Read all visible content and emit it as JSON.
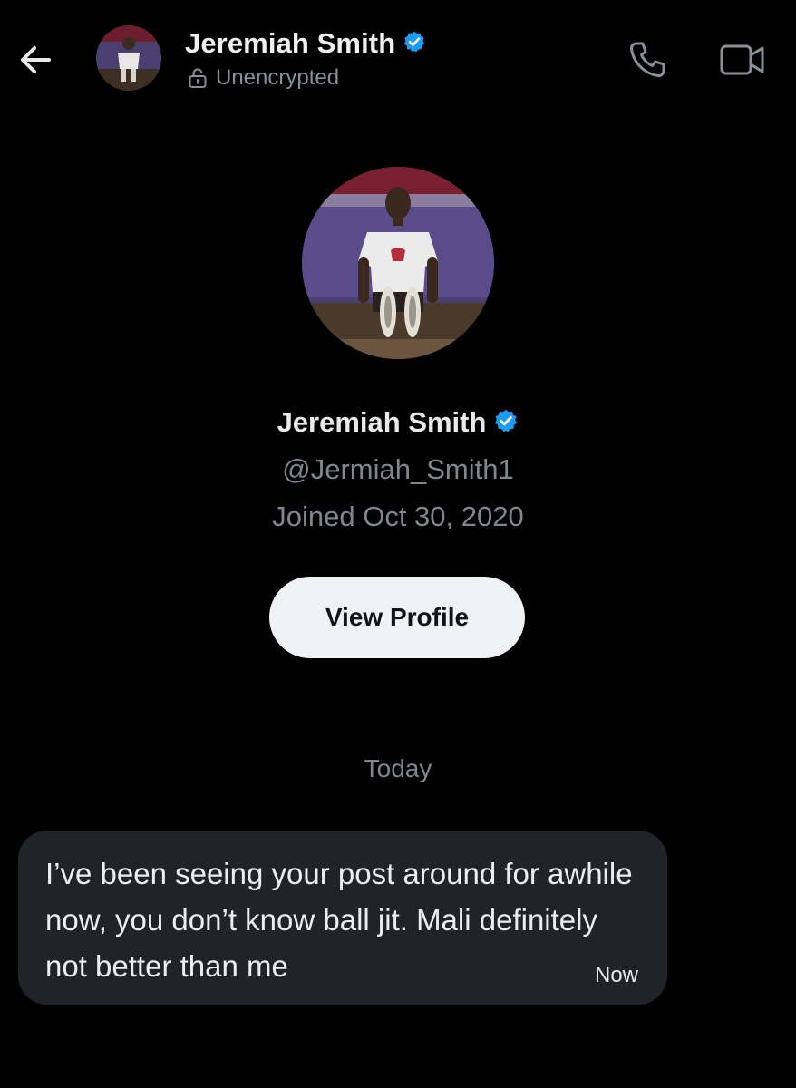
{
  "header": {
    "name": "Jeremiah Smith",
    "encryption_status": "Unencrypted",
    "back_icon": "arrow-left-icon",
    "call_icon": "phone-icon",
    "video_icon": "video-camera-icon"
  },
  "profile": {
    "name": "Jeremiah Smith",
    "handle": "@Jermiah_Smith1",
    "joined": "Joined Oct 30, 2020",
    "view_profile_label": "View Profile",
    "verified": true
  },
  "conversation": {
    "date_separator": "Today",
    "messages": [
      {
        "text": "I’ve been seeing your post around for awhile now, you don’t know ball jit. Mali definitely not better than me",
        "time": "Now"
      }
    ]
  },
  "colors": {
    "background": "#000000",
    "verified_badge": "#1d9bf0",
    "bubble": "#202327",
    "secondary_text": "#80868b",
    "button_bg": "#eff3f4"
  }
}
